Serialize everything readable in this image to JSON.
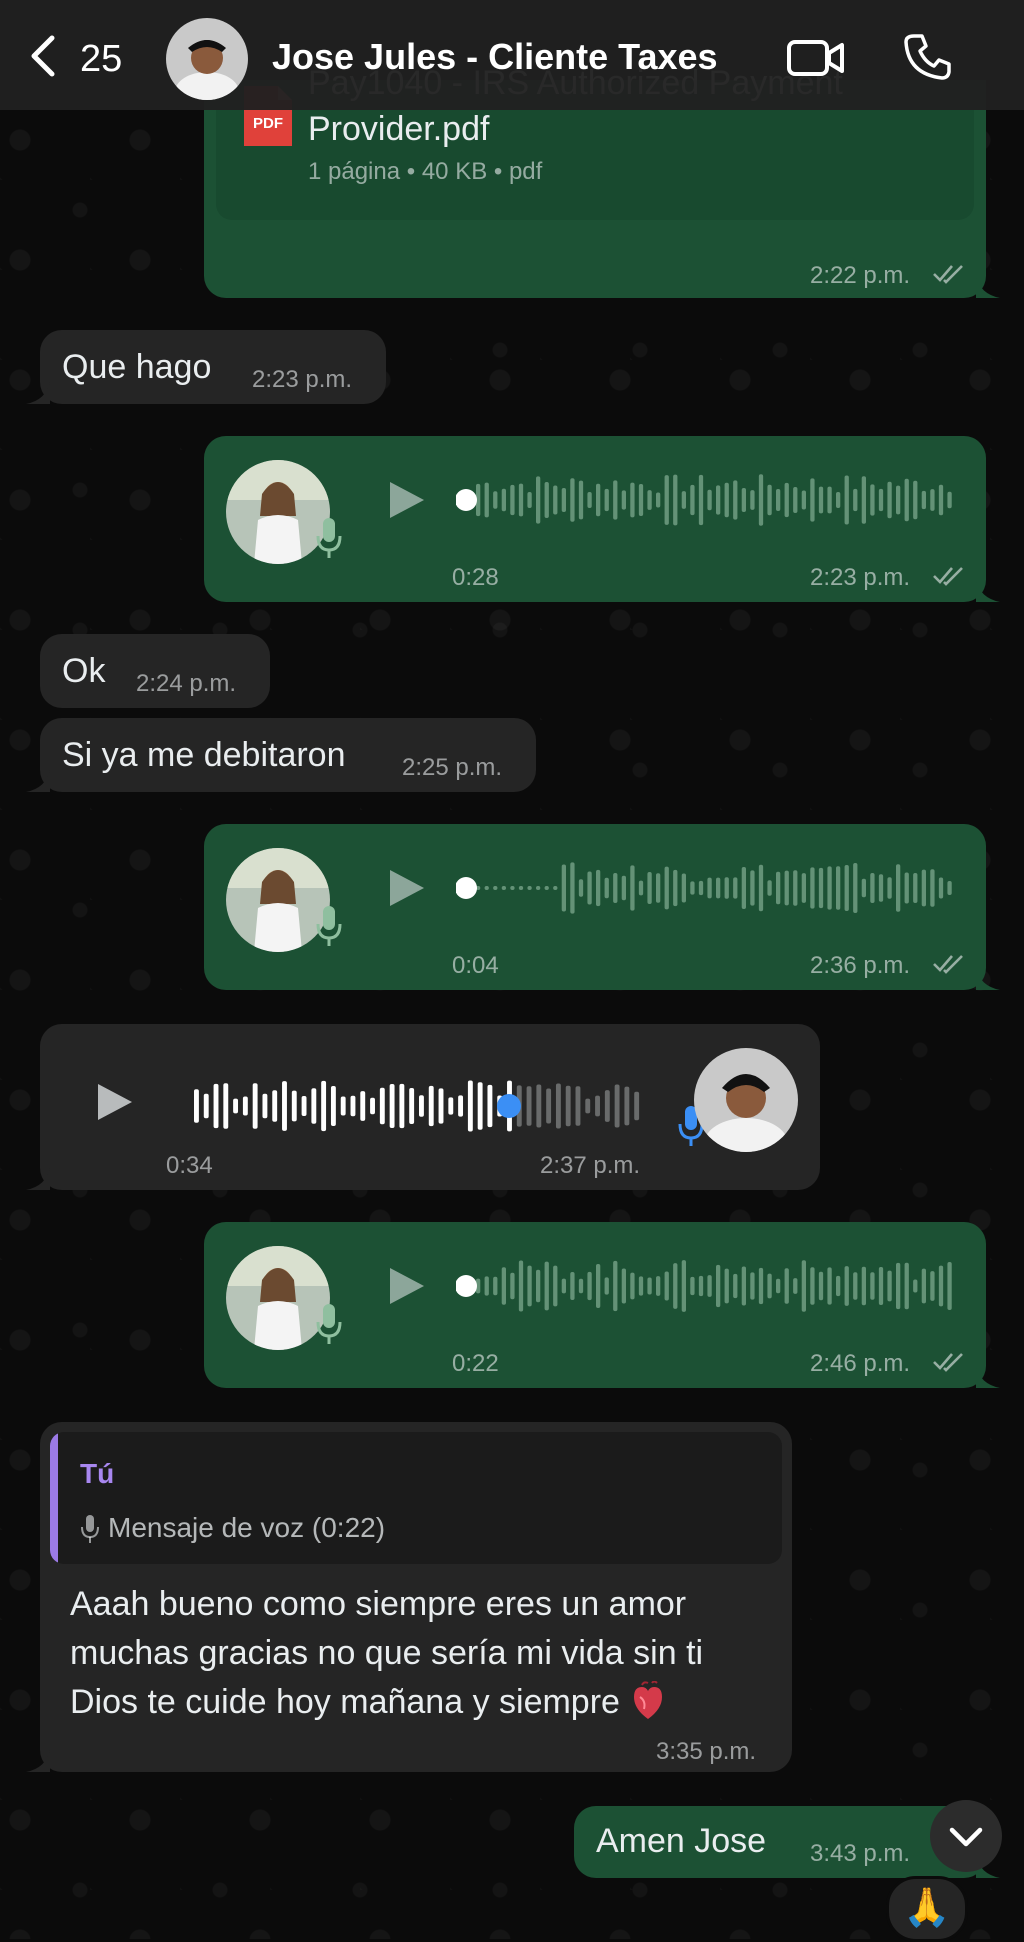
{
  "header": {
    "back_count": "25",
    "contact_name": "Jose Jules - Cliente Taxes"
  },
  "messages": [
    {
      "type": "document",
      "direction": "out",
      "file_name": "Pay1040 - IRS Authorized Payment Provider.pdf",
      "meta": "1 página • 40 KB • pdf",
      "time": "2:22 p.m."
    },
    {
      "type": "text",
      "direction": "in",
      "text": "Que hago",
      "time": "2:23 p.m."
    },
    {
      "type": "voice",
      "direction": "out",
      "duration": "0:28",
      "time": "2:23 p.m.",
      "progress": 0
    },
    {
      "type": "text",
      "direction": "in",
      "text": "Ok",
      "time": "2:24 p.m."
    },
    {
      "type": "text",
      "direction": "in",
      "text": "Si ya me debitaron",
      "time": "2:25 p.m."
    },
    {
      "type": "voice",
      "direction": "out",
      "duration": "0:04",
      "time": "2:36 p.m.",
      "progress": 0
    },
    {
      "type": "voice",
      "direction": "in",
      "duration": "0:34",
      "time": "2:37 p.m.",
      "progress": 0.7
    },
    {
      "type": "voice",
      "direction": "out",
      "duration": "0:22",
      "time": "2:46 p.m.",
      "progress": 0
    },
    {
      "type": "reply",
      "direction": "in",
      "quote_author": "Tú",
      "quote_text": "Mensaje de voz (0:22)",
      "lines": [
        "Aaah bueno como siempre eres un amor",
        "muchas gracias no que sería mi vida sin ti",
        "Dios te cuide hoy mañana y siempre"
      ],
      "time": "3:35 p.m."
    },
    {
      "type": "text",
      "direction": "out",
      "text": "Amen Jose",
      "time": "3:43 p.m.",
      "reaction": "🙏"
    }
  ],
  "colors": {
    "outgoing_bubble": "#1c5134",
    "incoming_bubble": "#252525",
    "background": "#0b0b0b",
    "quote_accent": "#9b7ae6",
    "played_dot": "#3b8ff5"
  },
  "icons": [
    "back-chevron-icon",
    "video-call-icon",
    "phone-icon",
    "pdf-icon",
    "play-icon",
    "mic-icon",
    "read-ticks-icon",
    "heart-icon",
    "scroll-down-icon"
  ]
}
